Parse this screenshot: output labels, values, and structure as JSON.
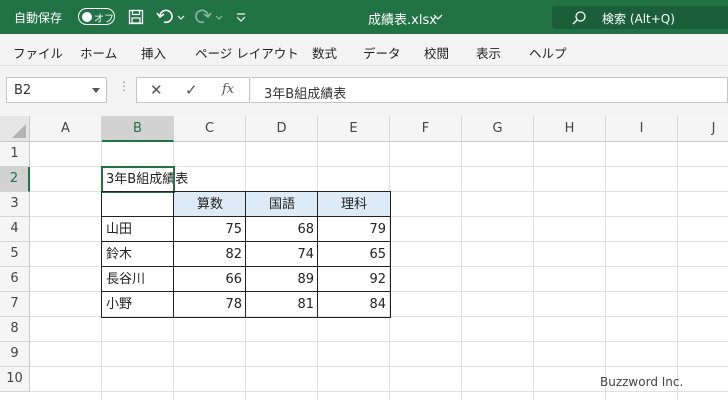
{
  "title_bar": {
    "autosave_label": "自動保存",
    "autosave_state": "オフ",
    "document_title": "成績表.xlsx",
    "search_placeholder": "検索 (Alt+Q)"
  },
  "ribbon": {
    "tabs": [
      "ファイル",
      "ホーム",
      "挿入",
      "ページ レイアウト",
      "数式",
      "データ",
      "校閲",
      "表示",
      "ヘルプ"
    ]
  },
  "formula_bar": {
    "name_box": "B2",
    "formula": "3年B組成績表"
  },
  "grid": {
    "columns": [
      "A",
      "B",
      "C",
      "D",
      "E",
      "F",
      "G",
      "H",
      "I",
      "J"
    ],
    "rows": [
      "1",
      "2",
      "3",
      "4",
      "5",
      "6",
      "7",
      "8",
      "9",
      "10"
    ],
    "selected_cell": "B2",
    "title_cell": "3年B組成績表",
    "table": {
      "headers": [
        "算数",
        "国語",
        "理科"
      ],
      "rows": [
        {
          "name": "山田",
          "values": [
            "75",
            "68",
            "79"
          ]
        },
        {
          "name": "鈴木",
          "values": [
            "82",
            "74",
            "65"
          ]
        },
        {
          "name": "長谷川",
          "values": [
            "66",
            "89",
            "92"
          ]
        },
        {
          "name": "小野",
          "values": [
            "78",
            "81",
            "84"
          ]
        }
      ]
    }
  },
  "watermark": "Buzzword Inc.",
  "colors": {
    "titlebar": "#217346",
    "header_fill": "#ddebf7",
    "selection": "#217346"
  }
}
